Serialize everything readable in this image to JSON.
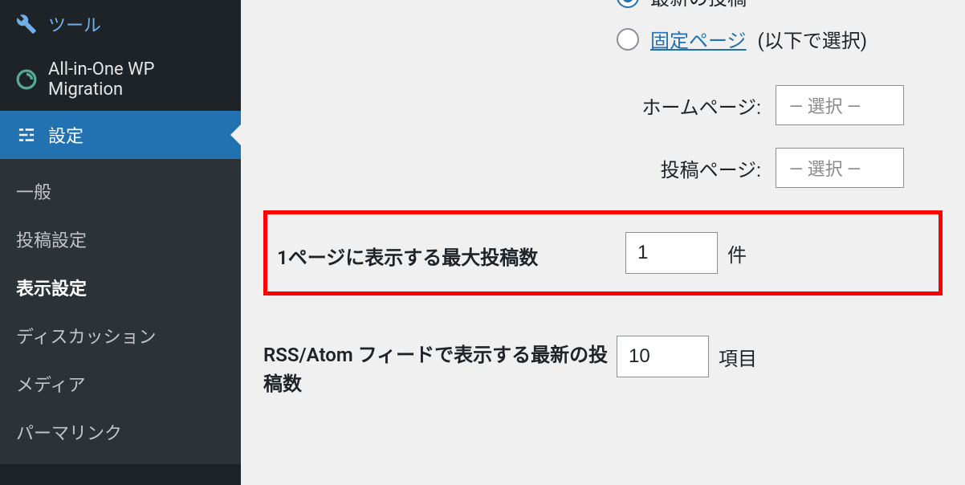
{
  "sidebar": {
    "tools": "ツール",
    "migration": "All-in-One WP Migration",
    "settings": "設定",
    "submenu": {
      "general": "一般",
      "writing": "投稿設定",
      "reading": "表示設定",
      "discussion": "ディスカッション",
      "media": "メディア",
      "permalink": "パーマリンク"
    }
  },
  "content": {
    "homepage_display": {
      "option_latest": "最新の投稿",
      "option_static": "固定ページ",
      "option_static_suffix": "(以下で選択)"
    },
    "selects": {
      "homepage_label": "ホームページ:",
      "posts_page_label": "投稿ページ:",
      "placeholder": "— 選択 —"
    },
    "posts_per_page": {
      "label": "1ページに表示する最大投稿数",
      "value": "1",
      "unit": "件"
    },
    "rss": {
      "label": "RSS/Atom フィードで表示する最新の投稿数",
      "value": "10",
      "unit": "項目"
    }
  }
}
